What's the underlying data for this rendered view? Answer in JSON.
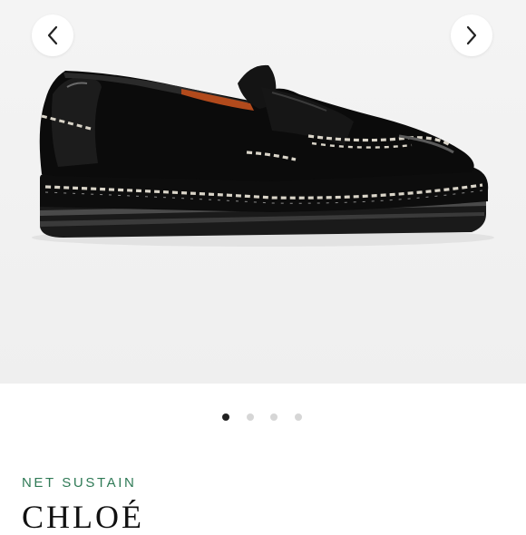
{
  "gallery": {
    "prev_icon": "chevron-left-icon",
    "next_icon": "chevron-right-icon",
    "product_image": "black patent leather loafer with contrast whipstitch trim",
    "image_count": 4,
    "active_index": 0
  },
  "product": {
    "tag": "NET SUSTAIN",
    "brand": "CHLOÉ"
  },
  "colors": {
    "tag_green": "#2f7a56",
    "dot_active": "#222222",
    "dot_inactive": "#d6d6d6",
    "background": "#f2f2f2"
  }
}
